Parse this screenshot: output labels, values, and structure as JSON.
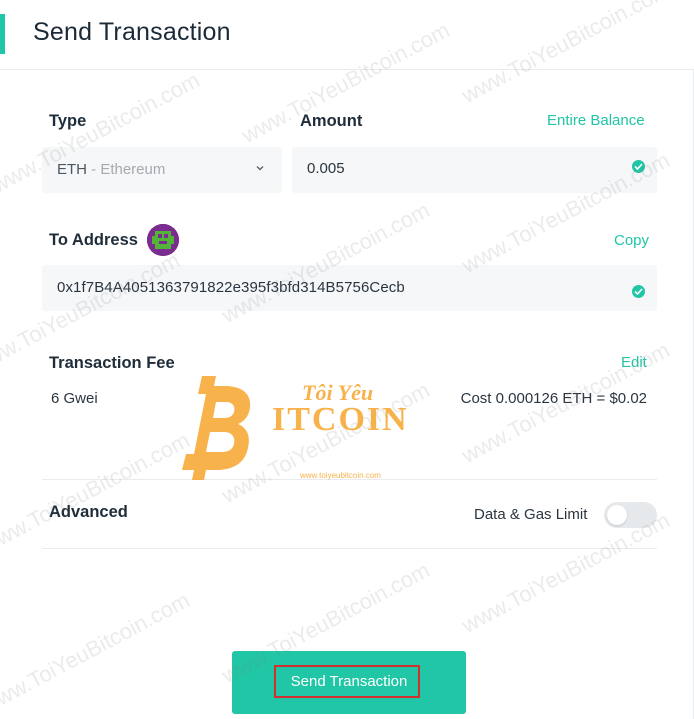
{
  "header": {
    "title": "Send Transaction"
  },
  "type": {
    "label": "Type",
    "selected_symbol": "ETH",
    "selected_name_suffix": " - Ethereum"
  },
  "amount": {
    "label": "Amount",
    "entire_balance_link": "Entire Balance",
    "value": "0.005"
  },
  "to_address": {
    "label": "To Address",
    "copy_link": "Copy",
    "value": "0x1f7B4A4051363791822e395f3bfd314B5756Cecb"
  },
  "fee": {
    "label": "Transaction Fee",
    "edit_link": "Edit",
    "gas_price": "6 Gwei",
    "cost": "Cost 0.000126 ETH = $0.02"
  },
  "advanced": {
    "label": "Advanced",
    "toggle_label": "Data & Gas Limit",
    "toggle_on": false
  },
  "send_button": {
    "label": "Send Transaction"
  },
  "watermark": {
    "text": "www.ToiYeuBitcoin.com",
    "logo_line1": "Tôi Yêu",
    "logo_line2": "ITCOIN",
    "logo_badge": "BITCOIN",
    "logo_url": "www.toiyeubitcoin.com"
  },
  "colors": {
    "accent": "#20c6a5",
    "highlight_border": "#d32f2f",
    "field_bg": "#f5f7f8",
    "logo_orange": "#f7a52d"
  }
}
